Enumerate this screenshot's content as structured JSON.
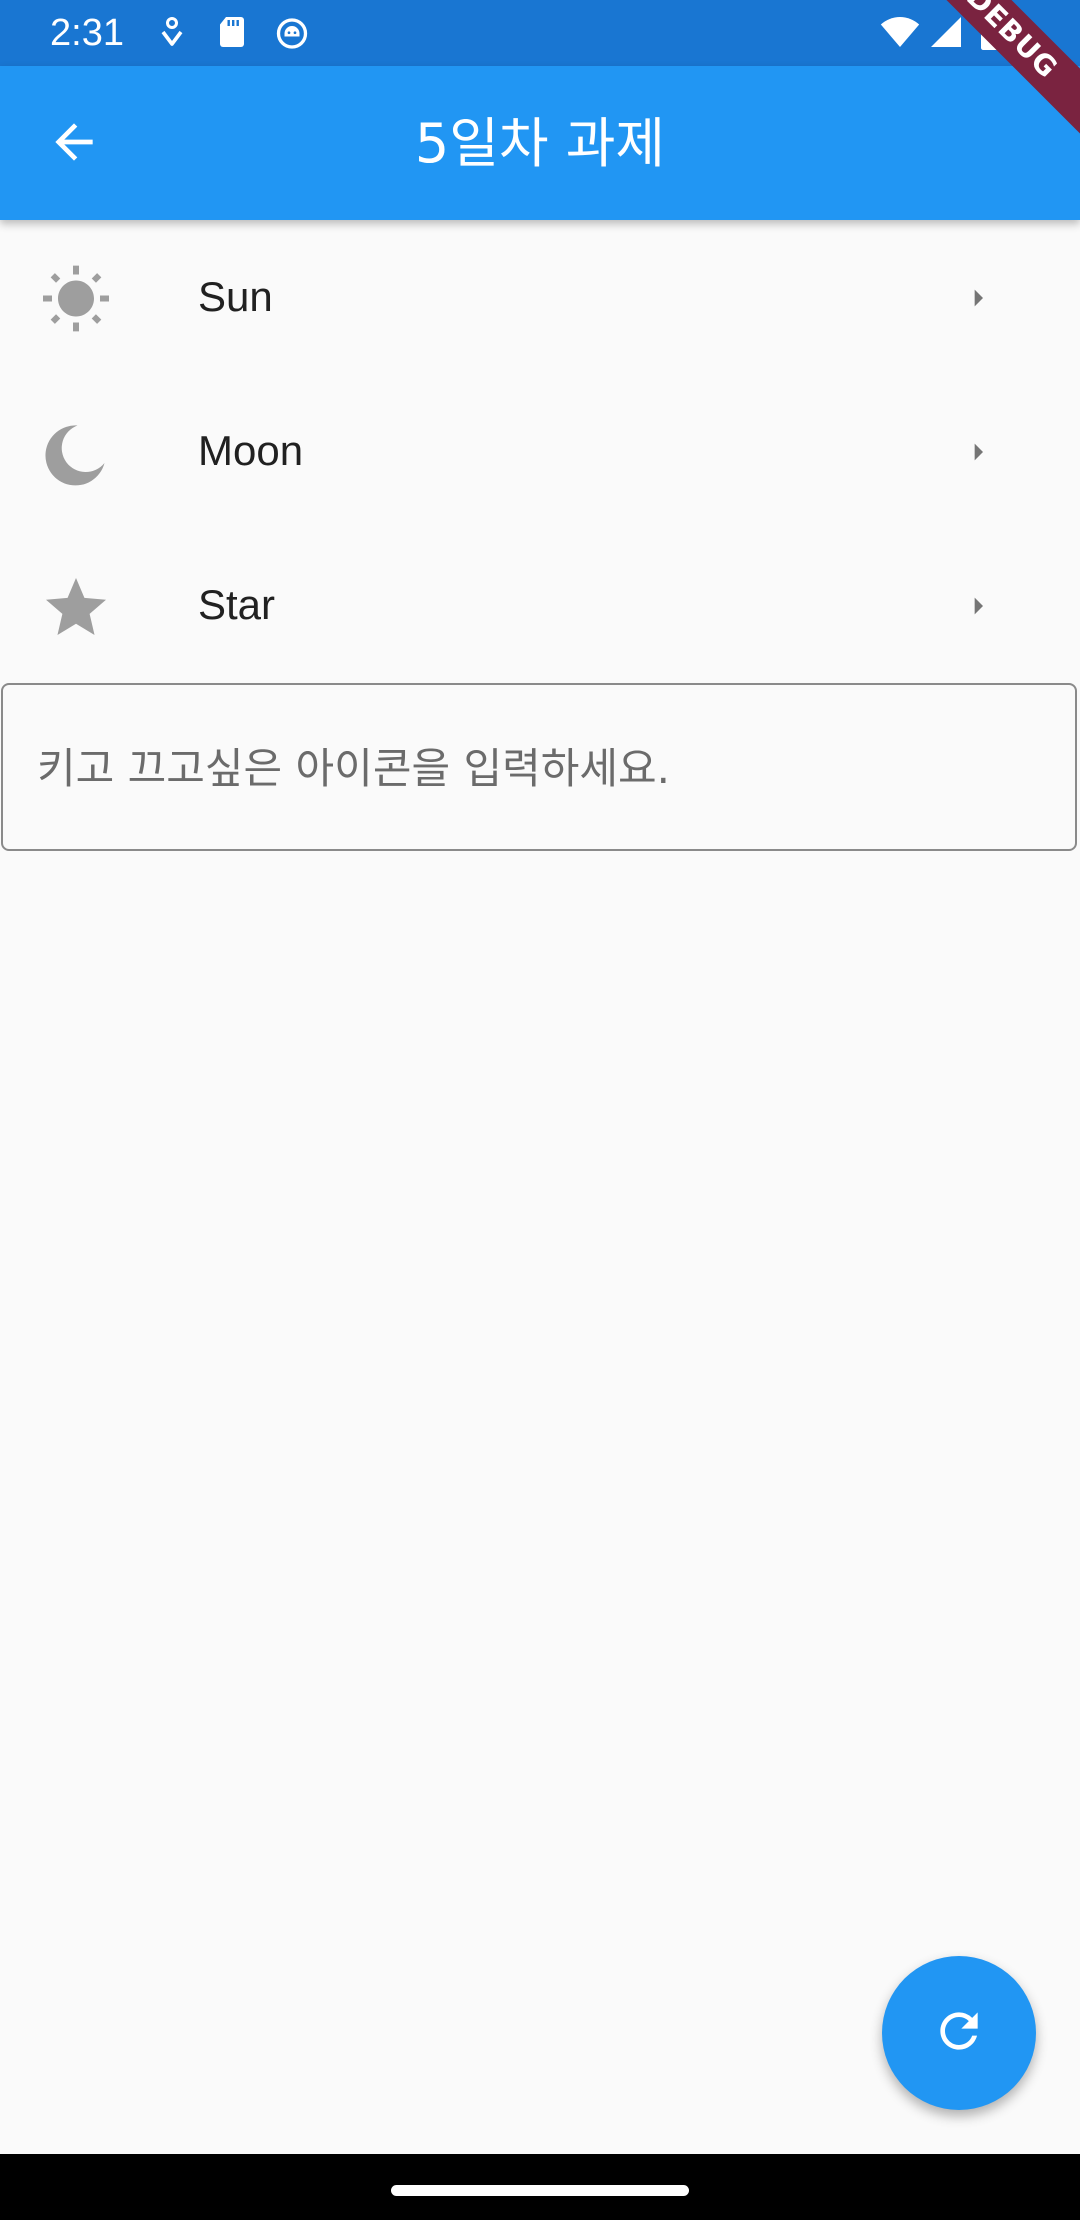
{
  "status_bar": {
    "time": "2:31",
    "icons": [
      "notification-icon",
      "sd-card-icon",
      "android-debug-icon",
      "wifi-icon",
      "signal-icon",
      "battery-icon"
    ]
  },
  "app_bar": {
    "title": "5일차 과제",
    "back_icon": "arrow-back-icon",
    "debug_banner": "DEBUG"
  },
  "list": {
    "items": [
      {
        "label": "Sun",
        "icon": "sun-icon",
        "trailing_icon": "arrow-right-icon"
      },
      {
        "label": "Moon",
        "icon": "moon-icon",
        "trailing_icon": "arrow-right-icon"
      },
      {
        "label": "Star",
        "icon": "star-icon",
        "trailing_icon": "arrow-right-icon"
      }
    ]
  },
  "text_field": {
    "value": "",
    "placeholder": "키고 끄고싶은 아이콘을 입력하세요."
  },
  "fab": {
    "icon": "refresh-icon"
  },
  "colors": {
    "primary": "#2196f3",
    "status_bar": "#1976d2",
    "icon_grey": "#9e9e9e",
    "background": "#fafafa",
    "debug_banner": "#7a2340"
  }
}
